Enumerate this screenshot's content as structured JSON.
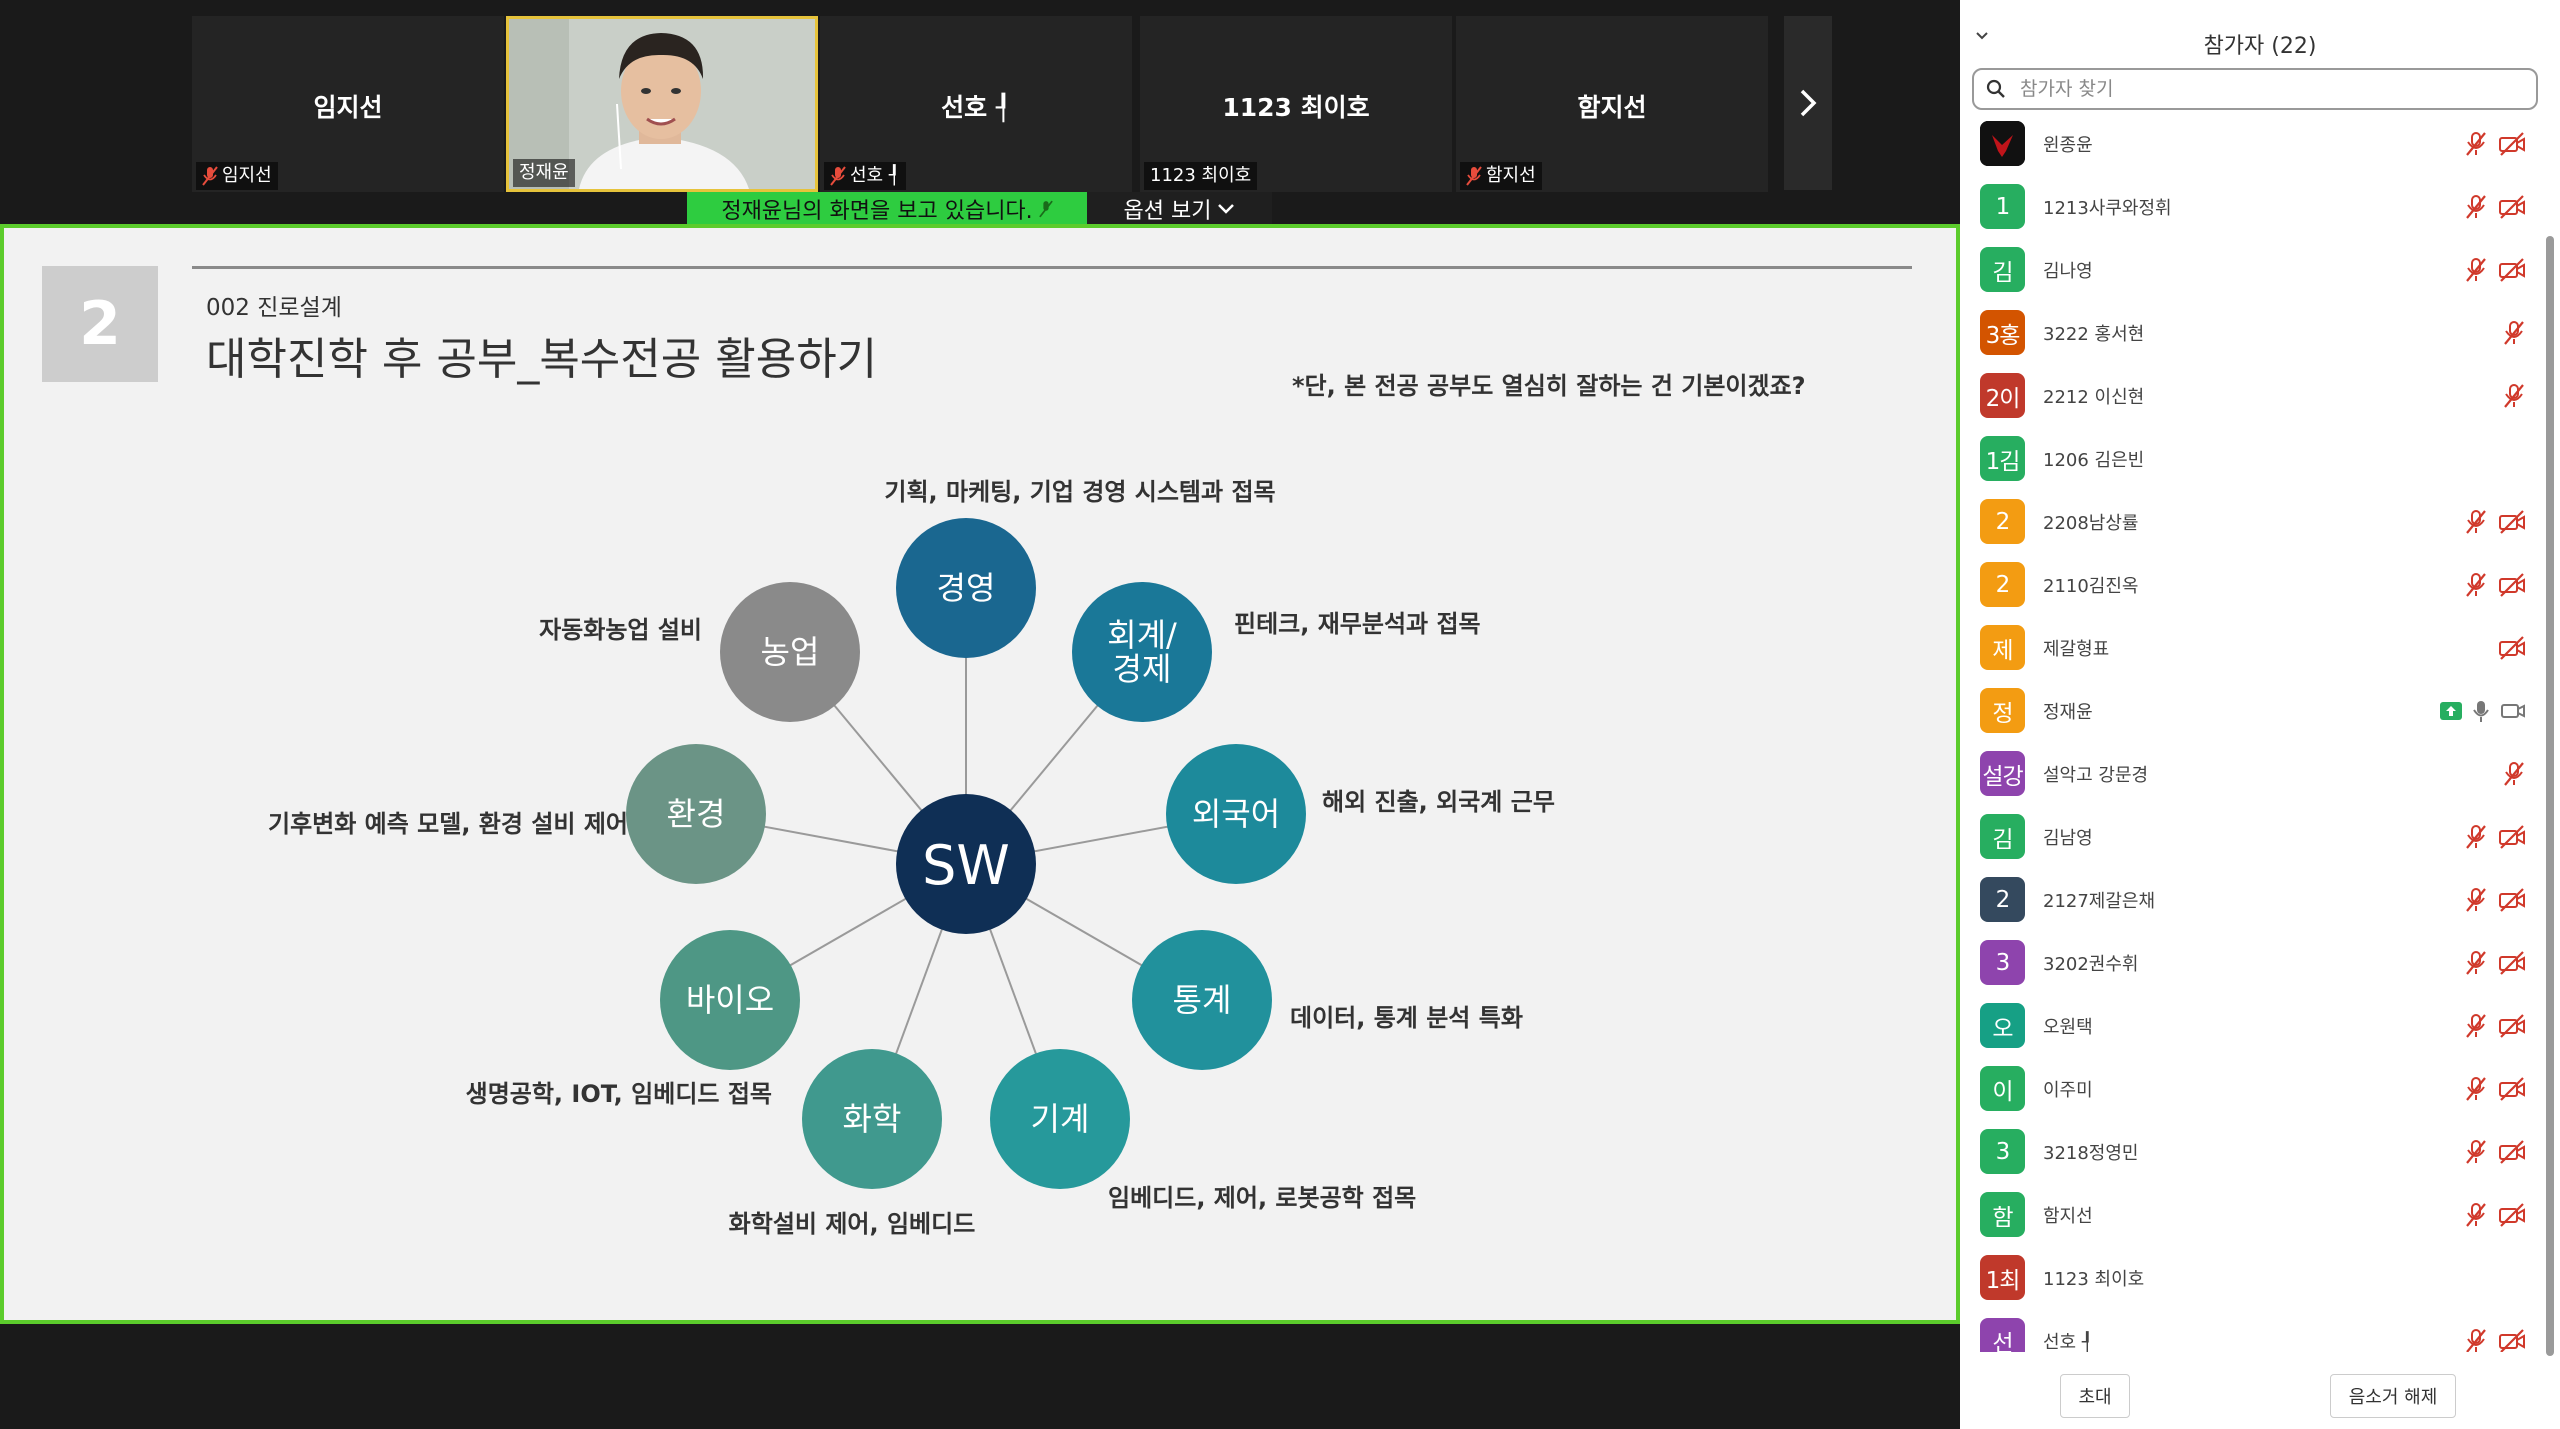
{
  "video_strip": {
    "tiles": [
      {
        "name": "임지선",
        "label": "임지선",
        "muted": true
      },
      {
        "name": "",
        "label": "정재윤",
        "muted": false
      },
      {
        "name": "선호 ┦",
        "label": "선호 ┦",
        "muted": true
      },
      {
        "name": "1123 최이호",
        "label": "1123 최이호",
        "muted": false
      },
      {
        "name": "함지선",
        "label": "함지선",
        "muted": true
      }
    ],
    "share_banner": "정재윤님의 화면을 보고 있습니다.",
    "view_options": "옵션 보기"
  },
  "slide": {
    "number": "2",
    "subtitle": "002 진로설계",
    "title": "대학진학 후 공부_복수전공 활용하기",
    "note": "*단, 본 전공 공부도 열심히 잘하는 건 기본이겠죠?",
    "center": "SW",
    "nodes": [
      {
        "label": "경영",
        "desc": "기획, 마케팅, 기업 경영 시스템과 접목",
        "color": "#1a6790"
      },
      {
        "label": "회계/\n경제",
        "desc": "핀테크, 재무분석과 접목",
        "color": "#1a7898"
      },
      {
        "label": "외국어",
        "desc": "해외 진출, 외국계 근무",
        "color": "#1d8a9b"
      },
      {
        "label": "통계",
        "desc": "데이터, 통계 분석 특화",
        "color": "#21919c"
      },
      {
        "label": "기계",
        "desc": "임베디드, 제어, 로봇공학 접목",
        "color": "#26999b"
      },
      {
        "label": "화학",
        "desc": "화학설비 제어, 임베디드",
        "color": "#40998e"
      },
      {
        "label": "바이오",
        "desc": "생명공학, IOT, 임베디드 접목",
        "color": "#4e9785"
      },
      {
        "label": "환경",
        "desc": "기후변화 예측 모델, 환경 설비 제어",
        "color": "#6b9486"
      },
      {
        "label": "농업",
        "desc": "자동화농업 설비",
        "color": "#8a8a8a"
      }
    ]
  },
  "panel": {
    "title": "참가자 (22)",
    "search_placeholder": "참가자 찾기",
    "participants": [
      {
        "avatar": "",
        "name": "윈종윤",
        "color": "#111111",
        "icons": [
          "mic-off",
          "video-off"
        ]
      },
      {
        "avatar": "1",
        "name": "1213사쿠와정휘",
        "color": "#27ae60",
        "icons": [
          "mic-off",
          "video-off"
        ]
      },
      {
        "avatar": "김",
        "name": "김나영",
        "color": "#27ae60",
        "icons": [
          "mic-off",
          "video-off"
        ]
      },
      {
        "avatar": "3홍",
        "name": "3222 홍서현",
        "color": "#d35400",
        "icons": [
          "mic-off"
        ]
      },
      {
        "avatar": "2이",
        "name": "2212 이신현",
        "color": "#c0392b",
        "icons": [
          "mic-off"
        ]
      },
      {
        "avatar": "1김",
        "name": "1206 김은빈",
        "color": "#27ae60",
        "icons": []
      },
      {
        "avatar": "2",
        "name": "2208남상률",
        "color": "#f39c12",
        "icons": [
          "mic-off",
          "video-off"
        ]
      },
      {
        "avatar": "2",
        "name": "2110김진옥",
        "color": "#f39c12",
        "icons": [
          "mic-off",
          "video-off"
        ]
      },
      {
        "avatar": "제",
        "name": "제갈형표",
        "color": "#f39c12",
        "icons": [
          "video-off"
        ]
      },
      {
        "avatar": "정",
        "name": "정재윤",
        "color": "#f39c12",
        "icons": [
          "share",
          "mic-on",
          "video-on"
        ]
      },
      {
        "avatar": "설강",
        "name": "설악고 강문경",
        "color": "#8e44ad",
        "icons": [
          "mic-off"
        ]
      },
      {
        "avatar": "김",
        "name": "김남영",
        "color": "#27ae60",
        "icons": [
          "mic-off",
          "video-off"
        ]
      },
      {
        "avatar": "2",
        "name": "2127제갈은채",
        "color": "#34495e",
        "icons": [
          "mic-off",
          "video-off"
        ]
      },
      {
        "avatar": "3",
        "name": "3202권수휘",
        "color": "#8e44ad",
        "icons": [
          "mic-off",
          "video-off"
        ]
      },
      {
        "avatar": "오",
        "name": "오원택",
        "color": "#16a085",
        "icons": [
          "mic-off",
          "video-off"
        ]
      },
      {
        "avatar": "이",
        "name": "이주미",
        "color": "#27ae60",
        "icons": [
          "mic-off",
          "video-off"
        ]
      },
      {
        "avatar": "3",
        "name": "3218정영민",
        "color": "#27ae60",
        "icons": [
          "mic-off",
          "video-off"
        ]
      },
      {
        "avatar": "함",
        "name": "함지선",
        "color": "#27ae60",
        "icons": [
          "mic-off",
          "video-off"
        ]
      },
      {
        "avatar": "1최",
        "name": "1123 최이호",
        "color": "#c0392b",
        "icons": []
      },
      {
        "avatar": "선",
        "name": "선호 ┦",
        "color": "#8e44ad",
        "icons": [
          "mic-off",
          "video-off"
        ]
      }
    ],
    "invite_label": "초대",
    "unmute_label": "음소거 해제"
  }
}
